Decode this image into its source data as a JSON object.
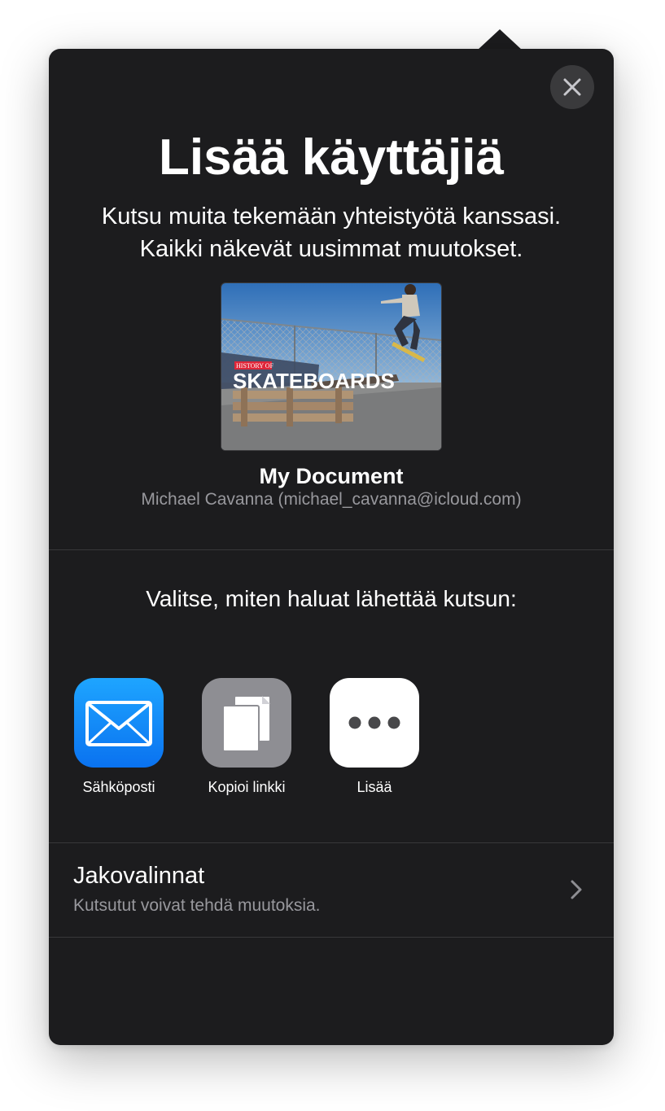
{
  "dialog": {
    "title": "Lisää käyttäjiä",
    "subtitle_line1": "Kutsu muita tekemään yhteistyötä kanssasi.",
    "subtitle_line2": "Kaikki näkevät uusimmat muutokset.",
    "close_icon": "close-icon"
  },
  "document": {
    "name": "My Document",
    "owner": "Michael Cavanna (michael_cavanna@icloud.com)",
    "thumbnail": {
      "banner_small": "HISTORY OF",
      "banner_large": "SKATEBOARDS"
    }
  },
  "invite": {
    "prompt": "Valitse, miten haluat lähettää kutsun:",
    "methods": [
      {
        "label": "Sähköposti",
        "icon": "mail-icon",
        "color": "#1a8cff"
      },
      {
        "label": "Kopioi linkki",
        "icon": "copy-icon",
        "color": "#8e8e93"
      },
      {
        "label": "Lisää",
        "icon": "more-icon",
        "color": "#ffffff"
      }
    ]
  },
  "sharing_options": {
    "title": "Jakovalinnat",
    "subtitle": "Kutsutut voivat tehdä muutoksia.",
    "icon": "chevron-right-icon"
  },
  "colors": {
    "background": "#1c1c1e",
    "text": "#ffffff",
    "secondary_text": "#98989d",
    "divider": "#38383a"
  }
}
